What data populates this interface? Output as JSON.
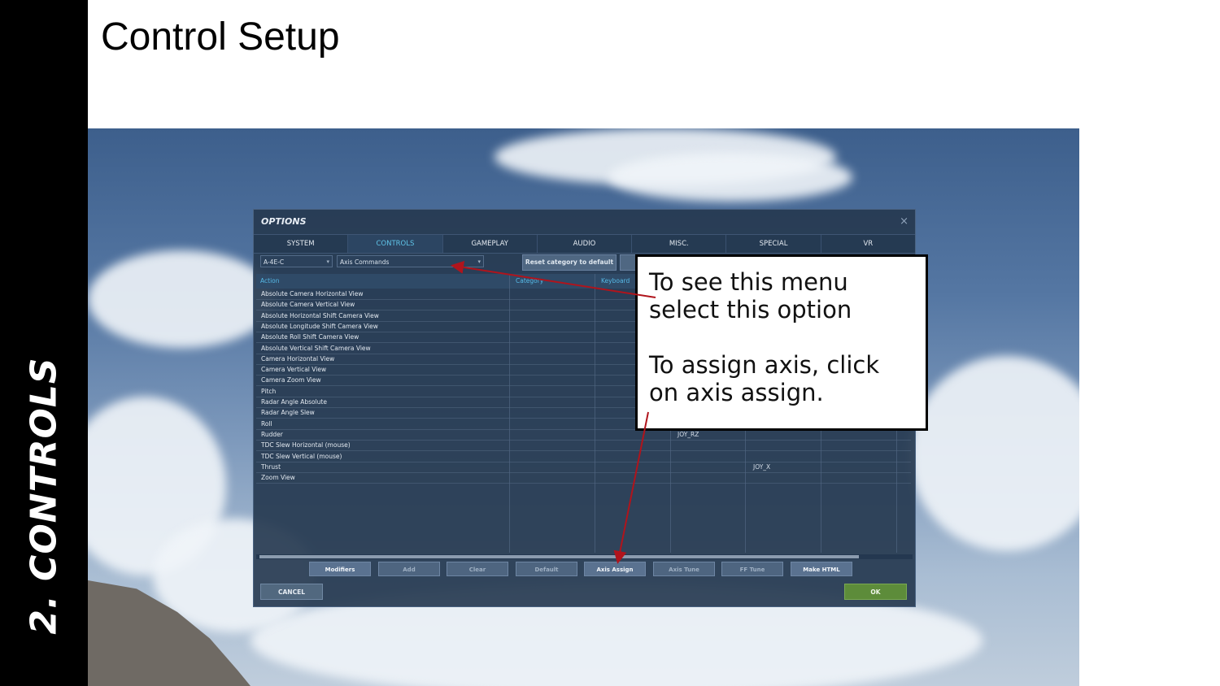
{
  "sidebar": {
    "label": "2. Controls"
  },
  "slide": {
    "title": "Control Setup"
  },
  "options": {
    "title": "OPTIONS",
    "close_symbol": "×",
    "tabs": [
      {
        "label": "SYSTEM",
        "active": false
      },
      {
        "label": "CONTROLS",
        "active": true
      },
      {
        "label": "GAMEPLAY",
        "active": false
      },
      {
        "label": "AUDIO",
        "active": false
      },
      {
        "label": "MISC.",
        "active": false
      },
      {
        "label": "SPECIAL",
        "active": false
      },
      {
        "label": "VR",
        "active": false
      }
    ],
    "aircraft_select": "A-4E-C",
    "category_select": "Axis Commands",
    "reset_button": "Reset category to default",
    "columns": {
      "action": "Action",
      "category": "Category",
      "keyboard": "Keyboard"
    },
    "rows": [
      {
        "action": "Absolute Camera Horizontal View",
        "col3": "",
        "col4": ""
      },
      {
        "action": "Absolute Camera Vertical View",
        "col3": "",
        "col4": ""
      },
      {
        "action": "Absolute Horizontal Shift Camera View",
        "col3": "",
        "col4": ""
      },
      {
        "action": "Absolute Longitude Shift Camera View",
        "col3": "",
        "col4": ""
      },
      {
        "action": "Absolute Roll Shift Camera View",
        "col3": "",
        "col4": ""
      },
      {
        "action": "Absolute Vertical Shift Camera View",
        "col3": "",
        "col4": ""
      },
      {
        "action": "Camera Horizontal View",
        "col3": "",
        "col4": ""
      },
      {
        "action": "Camera Vertical View",
        "col3": "",
        "col4": ""
      },
      {
        "action": "Camera Zoom View",
        "col3": "",
        "col4": ""
      },
      {
        "action": "Pitch",
        "col3": "",
        "col4": ""
      },
      {
        "action": "Radar Angle Absolute",
        "col3": "",
        "col4": ""
      },
      {
        "action": "Radar Angle Slew",
        "col3": "",
        "col4": ""
      },
      {
        "action": "Roll",
        "col3": "",
        "col4": ""
      },
      {
        "action": "Rudder",
        "col3": "JOY_RZ",
        "col4": ""
      },
      {
        "action": "TDC Slew Horizontal (mouse)",
        "col3": "",
        "col4": ""
      },
      {
        "action": "TDC Slew Vertical (mouse)",
        "col3": "",
        "col4": ""
      },
      {
        "action": "Thrust",
        "col3": "",
        "col4": "JOY_X"
      },
      {
        "action": "Zoom View",
        "col3": "",
        "col4": ""
      }
    ],
    "bottom_buttons": [
      {
        "label": "Modifiers",
        "enabled": true
      },
      {
        "label": "Add",
        "enabled": false
      },
      {
        "label": "Clear",
        "enabled": false
      },
      {
        "label": "Default",
        "enabled": false
      },
      {
        "label": "Axis Assign",
        "enabled": true
      },
      {
        "label": "Axis Tune",
        "enabled": false
      },
      {
        "label": "FF Tune",
        "enabled": false
      },
      {
        "label": "Make HTML",
        "enabled": true
      }
    ],
    "cancel": "CANCEL",
    "ok": "OK"
  },
  "callout": {
    "line1": "To see this menu select this option",
    "line2": "To assign axis, click on axis assign."
  },
  "colors": {
    "arrow": "#b0141c",
    "active_tab": "#5fc4e8",
    "ok_button": "#5d8c3a"
  }
}
